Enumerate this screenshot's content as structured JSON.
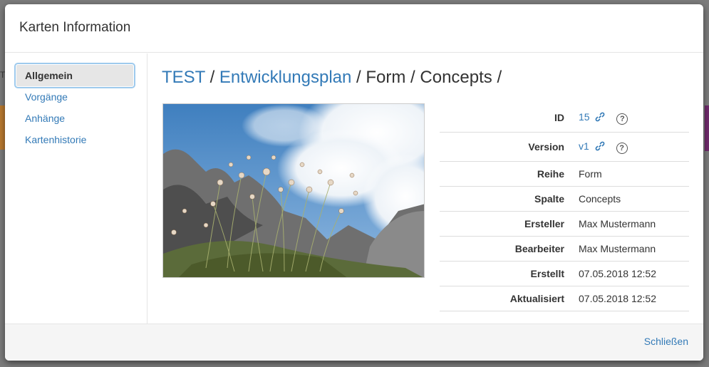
{
  "modal": {
    "title": "Karten Information",
    "close_label": "Schließen"
  },
  "nav": {
    "items": [
      {
        "label": "Allgemein",
        "active": true
      },
      {
        "label": "Vorgänge"
      },
      {
        "label": "Anhänge"
      },
      {
        "label": "Kartenhistorie"
      }
    ]
  },
  "breadcrumb": {
    "parts": [
      "TEST",
      "Entwicklungsplan",
      "Form",
      "Concepts"
    ],
    "separator": "/"
  },
  "info": {
    "rows": [
      {
        "label": "ID",
        "value": "15"
      },
      {
        "label": "Version",
        "value": "v1"
      },
      {
        "label": "Reihe",
        "value": "Form"
      },
      {
        "label": "Spalte",
        "value": "Concepts"
      },
      {
        "label": "Ersteller",
        "value": "Max Mustermann"
      },
      {
        "label": "Bearbeiter",
        "value": "Max Mustermann"
      },
      {
        "label": "Erstellt",
        "value": "07.05.2018 12:52"
      },
      {
        "label": "Aktualisiert",
        "value": "07.05.2018 12:52"
      }
    ]
  },
  "icons": {
    "link": "chain-link-icon",
    "help": "question-circle-icon"
  },
  "colors": {
    "link": "#337ab7",
    "overlay": "#7b7b7b",
    "nav_active_bg": "#e6e6e6"
  }
}
